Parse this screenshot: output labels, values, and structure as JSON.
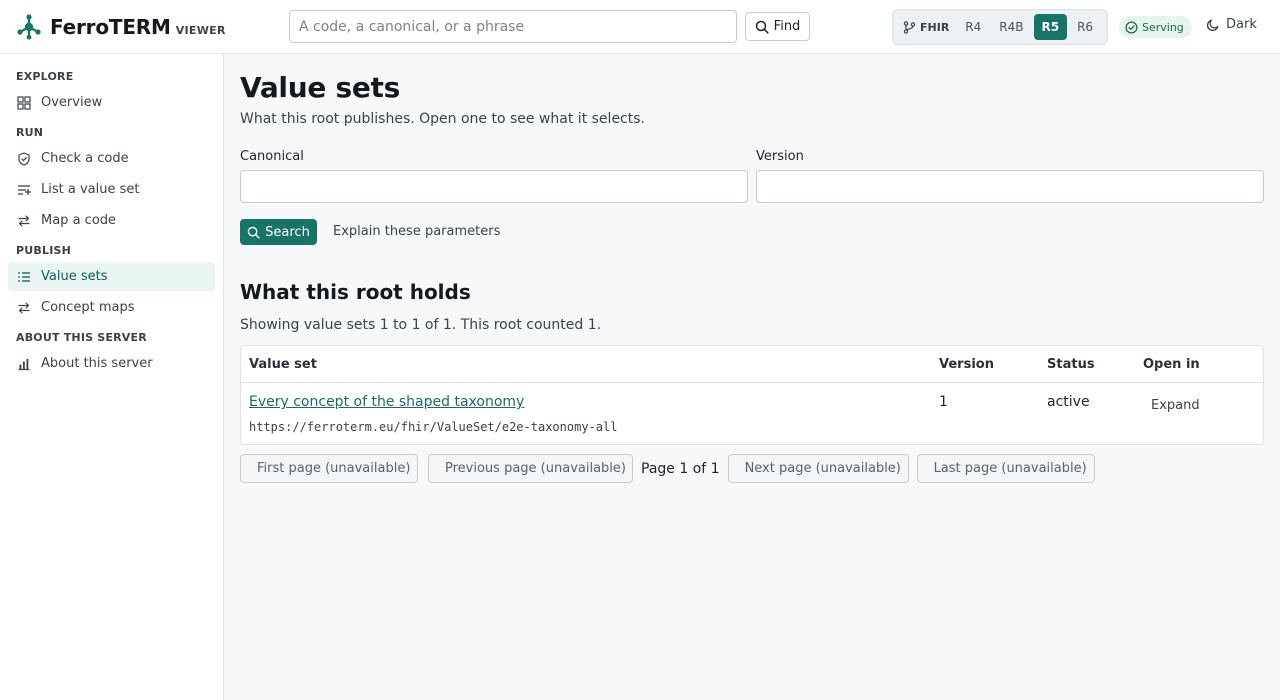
{
  "app": {
    "name": "FerroTERM",
    "subtitle": "VIEWER"
  },
  "header": {
    "search_placeholder": "A code, a canonical, or a phrase",
    "find_label": "Find",
    "fhir_label": "FHIR",
    "versions": [
      "R4",
      "R4B",
      "R5",
      "R6"
    ],
    "active_version": "R5",
    "status_label": "Serving",
    "theme_label": "Dark"
  },
  "sidebar": {
    "sections": [
      {
        "title": "EXPLORE",
        "items": [
          {
            "label": "Overview",
            "icon": "grid-icon"
          }
        ]
      },
      {
        "title": "RUN",
        "items": [
          {
            "label": "Check a code",
            "icon": "shield-check-icon"
          },
          {
            "label": "List a value set",
            "icon": "list-filter-icon"
          },
          {
            "label": "Map a code",
            "icon": "arrows-swap-icon"
          }
        ]
      },
      {
        "title": "PUBLISH",
        "items": [
          {
            "label": "Value sets",
            "icon": "list-icon",
            "active": true
          },
          {
            "label": "Concept maps",
            "icon": "arrows-swap-icon"
          }
        ]
      },
      {
        "title": "ABOUT THIS SERVER",
        "items": [
          {
            "label": "About this server",
            "icon": "bar-chart-icon"
          }
        ]
      }
    ]
  },
  "main": {
    "title": "Value sets",
    "subtitle": "What this root publishes. Open one to see what it selects.",
    "fields": {
      "canonical_label": "Canonical",
      "canonical_value": "",
      "version_label": "Version",
      "version_value": ""
    },
    "search_label": "Search",
    "explain_label": "Explain these parameters",
    "section_title": "What this root holds",
    "showing_text": "Showing value sets 1 to 1 of 1. This root counted 1.",
    "table": {
      "columns": [
        "Value set",
        "Version",
        "Status",
        "Open in"
      ],
      "rows": [
        {
          "title": "Every concept of the shaped taxonomy",
          "url": "https://ferroterm.eu/fhir/ValueSet/e2e-taxonomy-all",
          "version": "1",
          "status": "active",
          "action": "Expand"
        }
      ]
    },
    "pagination": {
      "first": "First page (unavailable)",
      "previous": "Previous page (unavailable)",
      "indicator": "Page 1 of 1",
      "next": "Next page (unavailable)",
      "last": "Last page (unavailable)"
    }
  },
  "colors": {
    "accent": "#177568",
    "link": "#1a6c61",
    "serving_bg": "#e3f5ec",
    "serving_text": "#1d6b45"
  }
}
